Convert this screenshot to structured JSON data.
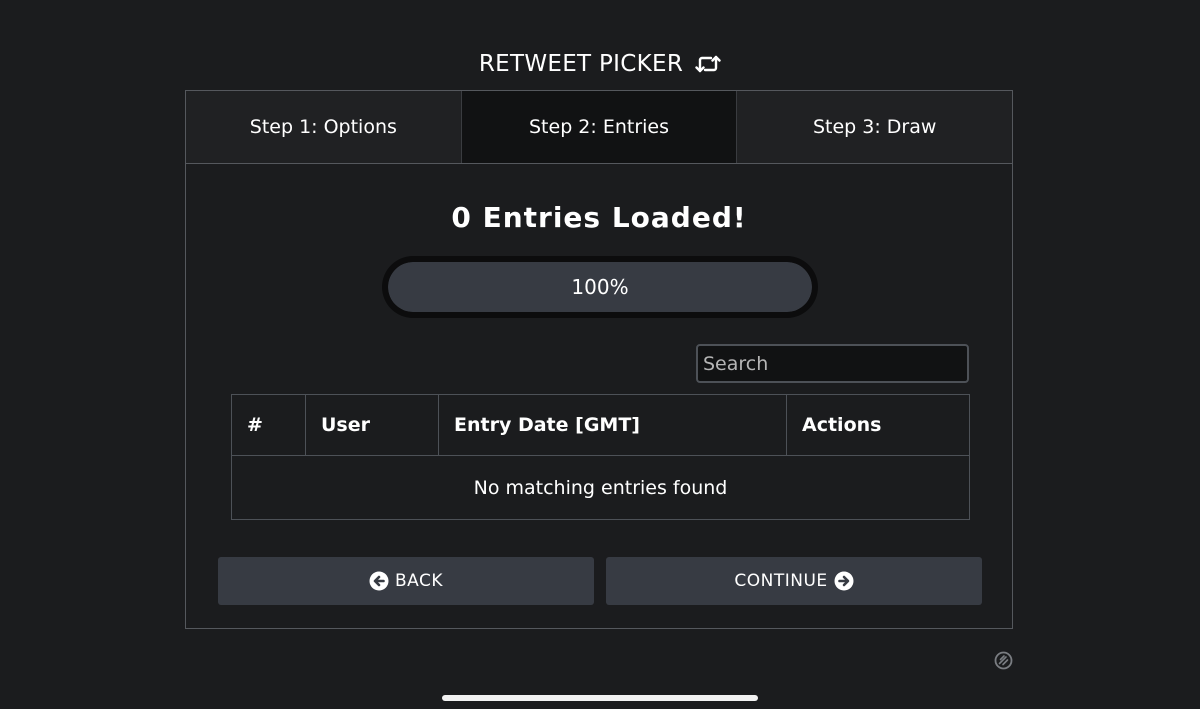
{
  "app": {
    "title": "RETWEET PICKER",
    "icon": "retweet-icon"
  },
  "tabs": [
    {
      "label": "Step 1: Options",
      "active": false
    },
    {
      "label": "Step 2: Entries",
      "active": true
    },
    {
      "label": "Step 3: Draw",
      "active": false
    }
  ],
  "entries": {
    "heading": "0 Entries Loaded!"
  },
  "progress": {
    "label": "100%",
    "value": 100
  },
  "search": {
    "placeholder": "Search",
    "value": ""
  },
  "table": {
    "columns": [
      "#",
      "User",
      "Entry Date [GMT]",
      "Actions"
    ],
    "empty_message": "No matching entries found"
  },
  "buttons": {
    "back": {
      "label": "BACK",
      "icon": "arrow-left-circle-icon"
    },
    "continue": {
      "label": "CONTINUE",
      "icon": "arrow-right-circle-icon"
    }
  },
  "colors": {
    "background": "#1b1c1e",
    "panel_border": "#55585d",
    "tab_bg": "#202123",
    "tab_active_bg": "#111213",
    "progress_fill": "#373b43",
    "button_bg": "#373b43",
    "text": "#ffffff"
  }
}
